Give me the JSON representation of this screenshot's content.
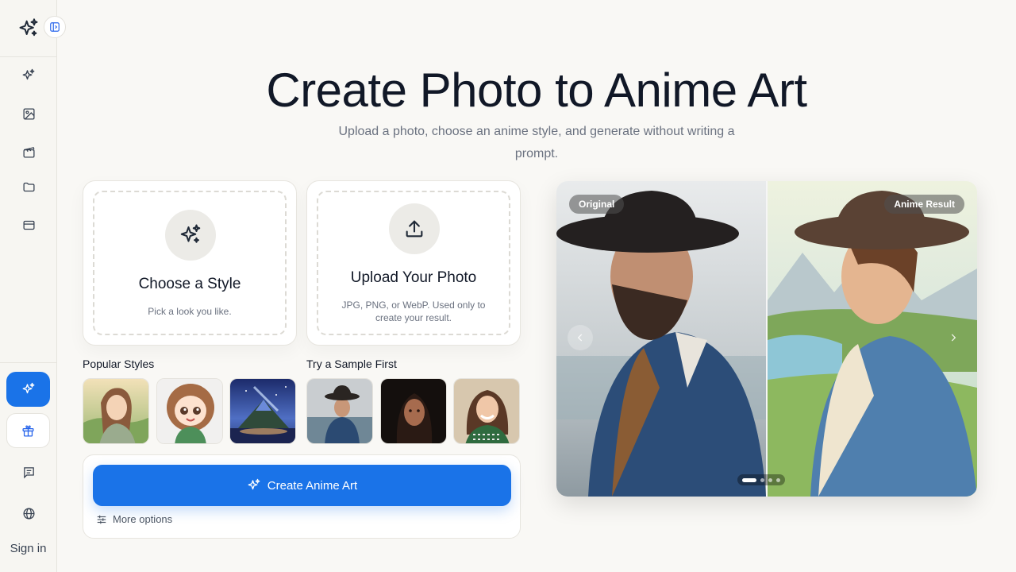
{
  "hero": {
    "title": "Create Photo to Anime Art",
    "subtitle": "Upload a photo, choose an anime style, and generate without writing a prompt."
  },
  "style_card": {
    "icon": "sparkles-icon",
    "title": "Choose a Style",
    "description": "Pick a look you like."
  },
  "upload_card": {
    "icon": "upload-icon",
    "title": "Upload Your Photo",
    "description": "JPG, PNG, or WebP. Used only to create your result."
  },
  "popular_styles": {
    "label": "Popular Styles",
    "items": [
      "watercolor-portrait-thumb",
      "chibi-cartoon-thumb",
      "fantasy-landscape-thumb"
    ]
  },
  "samples": {
    "label": "Try a Sample First",
    "items": [
      "cowboy-sample-thumb",
      "dark-portrait-sample-thumb",
      "smiling-woman-sample-thumb"
    ]
  },
  "create": {
    "button_label": "Create Anime Art",
    "more_options_label": "More options"
  },
  "compare": {
    "original_label": "Original",
    "result_label": "Anime Result",
    "slide_count": 4,
    "active_slide": 1
  },
  "sidebar": {
    "items": [
      "sparkles-icon",
      "image-icon",
      "video-icon",
      "folder-icon",
      "card-icon"
    ],
    "sign_in_label": "Sign in"
  },
  "colors": {
    "accent": "#1a73e8",
    "background": "#f9f8f5"
  }
}
